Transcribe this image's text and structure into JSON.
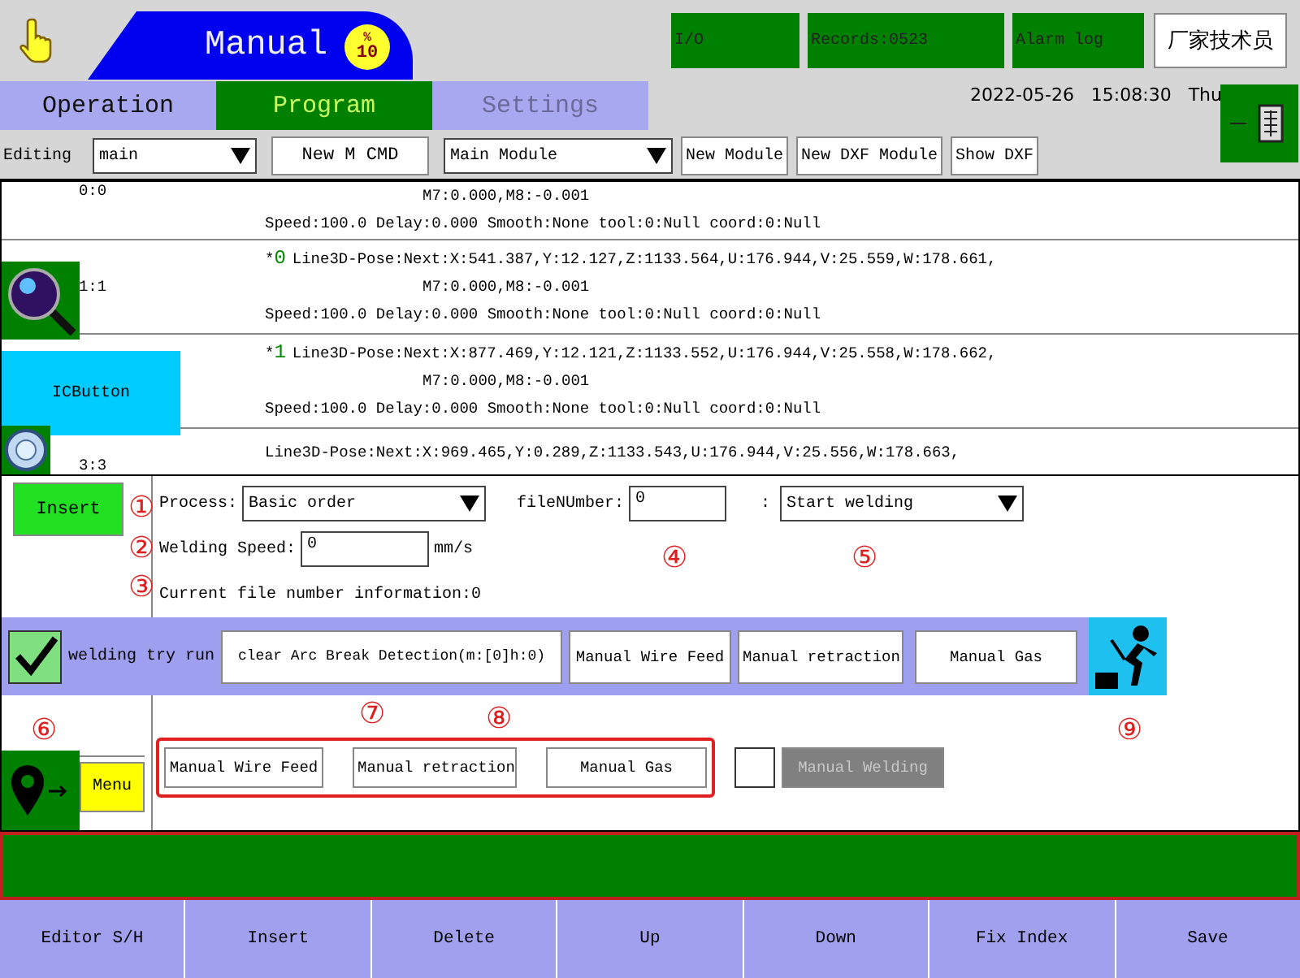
{
  "header": {
    "mode": "Manual",
    "gauge_unit": "%",
    "gauge_value": "10",
    "buttons": [
      {
        "label": "I/O"
      },
      {
        "label": "Records:0523"
      },
      {
        "label": "Alarm log"
      }
    ],
    "user": "厂家技术员"
  },
  "tabs": [
    {
      "label": "Operation",
      "selected": false,
      "disabled": false
    },
    {
      "label": "Program",
      "selected": true,
      "disabled": false
    },
    {
      "label": "Settings",
      "selected": false,
      "disabled": true
    }
  ],
  "datetime": "2022-05-26   15:08:30   Thu",
  "toolbar": {
    "label": "Editing",
    "module_select": "main",
    "new_cmd": "New M CMD",
    "module_type_select": "Main Module",
    "buttons": [
      "New Module",
      "New DXF Module",
      "Show DXF"
    ]
  },
  "program": {
    "rows": [
      {
        "index": "0:0",
        "lines": [
          "M7:0.000,M8:-0.001",
          "Speed:100.0 Delay:0.000 Smooth:None tool:0:Null coord:0:Null"
        ]
      },
      {
        "index": "1:1",
        "marker": {
          "prefix": "*",
          "number": "0"
        },
        "lines": [
          "Line3D-Pose:Next:X:541.387,Y:12.127,Z:1133.564,U:176.944,V:25.559,W:178.661,",
          "M7:0.000,M8:-0.001",
          "Speed:100.0 Delay:0.000 Smooth:None tool:0:Null coord:0:Null"
        ]
      },
      {
        "marker": {
          "prefix": "*",
          "number": "1"
        },
        "lines": [
          "Line3D-Pose:Next:X:877.469,Y:12.121,Z:1133.552,U:176.944,V:25.558,W:178.662,",
          "M7:0.000,M8:-0.001",
          "Speed:100.0 Delay:0.000 Smooth:None tool:0:Null coord:0:Null"
        ]
      },
      {
        "index": "3:3",
        "lines": [
          "Line3D-Pose:Next:X:969.465,Y:0.289,Z:1133.543,U:176.944,V:25.556,W:178.663,"
        ]
      }
    ]
  },
  "ic_button": "ICButton",
  "edit": {
    "insert": "Insert",
    "menu": "Menu",
    "process_label": "Process:",
    "process": "Basic order",
    "file_label": "fileNUmber:",
    "file_value": "0",
    "colon": ":",
    "action": "Start welding",
    "speed_label": "Welding Speed:",
    "speed_value": "0",
    "speed_unit": "mm/s",
    "info": "Current file number information:0"
  },
  "try_run": {
    "checked": true,
    "label": "welding try run",
    "buttons": [
      "clear Arc Break Detection(m:[0]h:0)",
      "Manual Wire Feed",
      "Manual retraction",
      "Manual Gas"
    ]
  },
  "manual_group": {
    "buttons": [
      "Manual Wire Feed",
      "Manual retraction",
      "Manual Gas"
    ]
  },
  "manual_welding": {
    "checked": false,
    "label": "Manual Welding",
    "disabled": true
  },
  "annotations": [
    "①",
    "②",
    "③",
    "④",
    "⑤",
    "⑥",
    "⑦",
    "⑧",
    "⑨"
  ],
  "bottom_buttons": [
    "Editor S/H",
    "Insert",
    "Delete",
    "Up",
    "Down",
    "Fix Index",
    "Save"
  ]
}
